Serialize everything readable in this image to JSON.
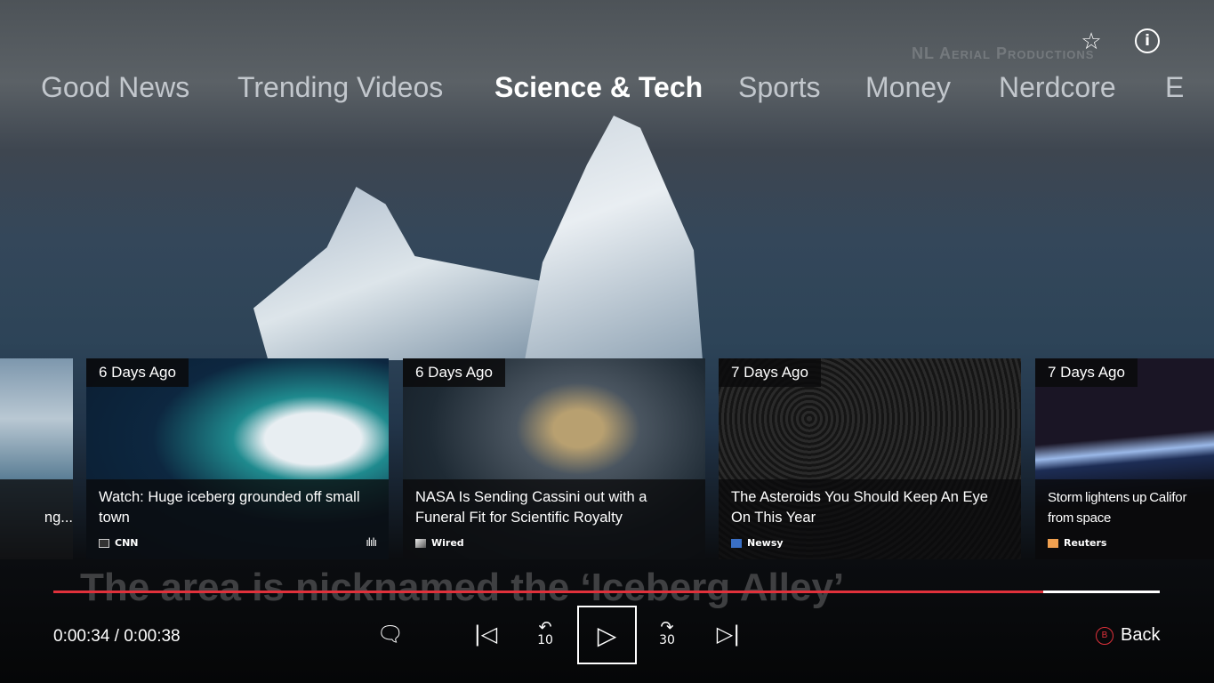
{
  "watermark": "NL Aerial Productions",
  "header": {
    "icons": [
      "favorites-list-icon",
      "info-icon"
    ]
  },
  "tabs": [
    {
      "label": "Good News"
    },
    {
      "label": "Trending Videos"
    },
    {
      "label": "Science & Tech",
      "active": true
    },
    {
      "label": "Sports"
    },
    {
      "label": "Money"
    },
    {
      "label": "Nerdcore"
    },
    {
      "label": "E"
    }
  ],
  "cards": [
    {
      "date": "",
      "title": "ng...",
      "source": ""
    },
    {
      "date": "6 Days Ago",
      "title": "Watch: Huge iceberg grounded off small town",
      "source": "CNN",
      "playing": true
    },
    {
      "date": "6 Days Ago",
      "title": "NASA Is Sending Cassini out with a Funeral Fit for Scientific Royalty",
      "source": "Wired"
    },
    {
      "date": "7 Days Ago",
      "title": "The Asteroids You Should Keep An Eye On This Year",
      "source": "Newsy"
    },
    {
      "date": "7 Days Ago",
      "title": "Storm lightens up Califor from space",
      "source": "Reuters"
    }
  ],
  "player": {
    "caption": "The area is nicknamed the ‘Iceberg Alley’",
    "time": "0:00:34 / 0:00:38",
    "progress": 0.895,
    "accent": "#e0313b",
    "skip_back": "10",
    "skip_forward": "30",
    "back_label": "Back",
    "back_button": "B"
  }
}
